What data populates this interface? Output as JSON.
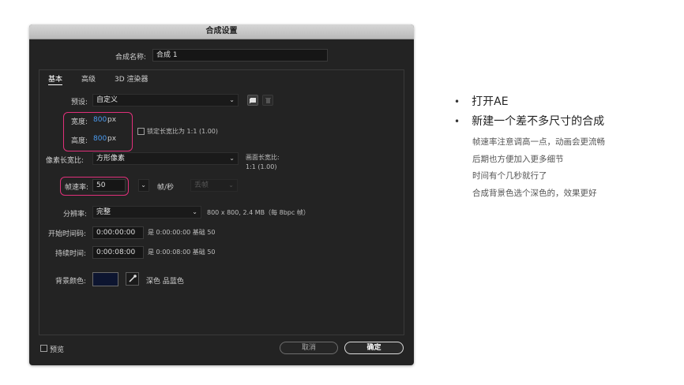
{
  "dialog": {
    "title": "合成设置",
    "comp_name_label": "合成名称:",
    "comp_name_value": "合成 1",
    "tabs": [
      "基本",
      "高级",
      "3D 渲染器"
    ],
    "preset_label": "预设:",
    "preset_value": "自定义",
    "width_label": "宽度:",
    "width_value": "800",
    "width_unit": "px",
    "height_label": "高度:",
    "height_value": "800",
    "height_unit": "px",
    "lock_aspect_label": "锁定长宽比为 1:1 (1.00)",
    "pixel_aspect_label": "像素长宽比:",
    "pixel_aspect_value": "方形像素",
    "frame_aspect_label": "画面长宽比:",
    "frame_aspect_value": "1:1 (1.00)",
    "frame_rate_label": "帧速率:",
    "frame_rate_value": "50",
    "fps_label": "帧/秒",
    "drop_frame_value": "丢帧",
    "resolution_label": "分辨率:",
    "resolution_value": "完整",
    "resolution_info": "800 x 800, 2.4 MB（每 8bpc 帧）",
    "start_tc_label": "开始时间码:",
    "start_tc_value": "0:00:00:00",
    "start_tc_info": "是 0:00:00:00  基础 50",
    "duration_label": "持续时间:",
    "duration_value": "0:00:08:00",
    "duration_info": "是 0:00:08:00  基础 50",
    "bg_color_label": "背景颜色:",
    "bg_color_hex": "#0d1530",
    "bg_color_name": "深色 品蓝色",
    "preview_label": "预览",
    "cancel_label": "取消",
    "ok_label": "确定"
  },
  "notes": {
    "bullets": [
      "打开AE",
      "新建一个差不多尺寸的合成"
    ],
    "lines": [
      "帧速率注意调高一点，动画会更流畅",
      "后期也方便加入更多细节",
      "时间有个几秒就行了",
      "合成背景色选个深色的，效果更好"
    ]
  },
  "colors": {
    "highlight": "#e0307a",
    "link_blue": "#4a9bf0",
    "dialog_bg": "#232323"
  }
}
